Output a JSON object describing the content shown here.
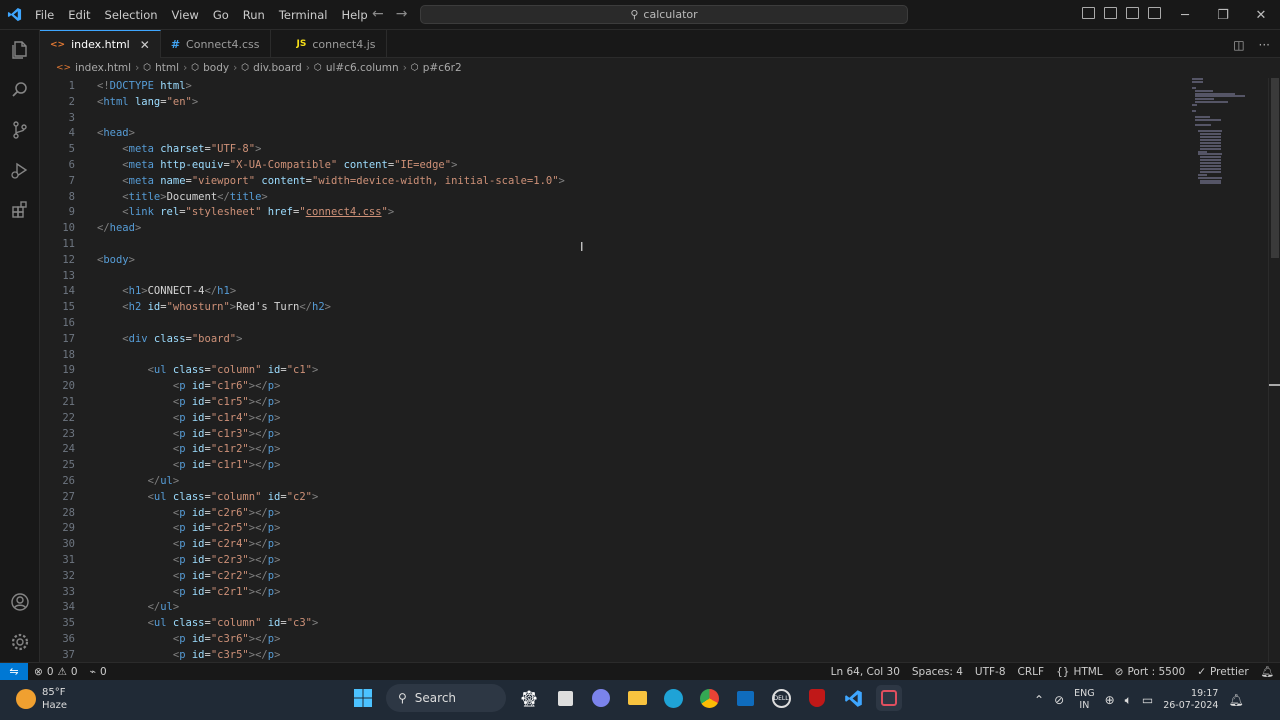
{
  "menu": [
    "File",
    "Edit",
    "Selection",
    "View",
    "Go",
    "Run",
    "Terminal",
    "Help"
  ],
  "search": {
    "text": "calculator"
  },
  "tabs": [
    {
      "label": "index.html",
      "icon": "<>",
      "color": "#e37933",
      "active": true
    },
    {
      "label": "Connect4.css",
      "icon": "#",
      "color": "#42a5f5",
      "active": false
    },
    {
      "label": "connect4.js",
      "icon": "JS",
      "color": "#f5de19",
      "active": false
    }
  ],
  "breadcrumb": [
    "index.html",
    "html",
    "body",
    "div.board",
    "ul#c6.column",
    "p#c6r2"
  ],
  "code": [
    [
      [
        "t",
        "<!"
      ],
      [
        "tn",
        "DOCTYPE "
      ],
      [
        "an",
        "html"
      ],
      [
        "t",
        ">"
      ]
    ],
    [
      [
        "t",
        "<"
      ],
      [
        "tn",
        "html "
      ],
      [
        "an",
        "lang"
      ],
      [
        "tx",
        "="
      ],
      [
        "av",
        "\"en\""
      ],
      [
        "t",
        ">"
      ]
    ],
    [],
    [
      [
        "t",
        "<"
      ],
      [
        "tn",
        "head"
      ],
      [
        "t",
        ">"
      ]
    ],
    [
      [
        "tx",
        "    "
      ],
      [
        "t",
        "<"
      ],
      [
        "tn",
        "meta "
      ],
      [
        "an",
        "charset"
      ],
      [
        "tx",
        "="
      ],
      [
        "av",
        "\"UTF-8\""
      ],
      [
        "t",
        ">"
      ]
    ],
    [
      [
        "tx",
        "    "
      ],
      [
        "t",
        "<"
      ],
      [
        "tn",
        "meta "
      ],
      [
        "an",
        "http-equiv"
      ],
      [
        "tx",
        "="
      ],
      [
        "av",
        "\"X-UA-Compatible\" "
      ],
      [
        "an",
        "content"
      ],
      [
        "tx",
        "="
      ],
      [
        "av",
        "\"IE=edge\""
      ],
      [
        "t",
        ">"
      ]
    ],
    [
      [
        "tx",
        "    "
      ],
      [
        "t",
        "<"
      ],
      [
        "tn",
        "meta "
      ],
      [
        "an",
        "name"
      ],
      [
        "tx",
        "="
      ],
      [
        "av",
        "\"viewport\" "
      ],
      [
        "an",
        "content"
      ],
      [
        "tx",
        "="
      ],
      [
        "av",
        "\"width=device-width, initial-scale=1.0\""
      ],
      [
        "t",
        ">"
      ]
    ],
    [
      [
        "tx",
        "    "
      ],
      [
        "t",
        "<"
      ],
      [
        "tn",
        "title"
      ],
      [
        "t",
        ">"
      ],
      [
        "tx",
        "Document"
      ],
      [
        "t",
        "</"
      ],
      [
        "tn",
        "title"
      ],
      [
        "t",
        ">"
      ]
    ],
    [
      [
        "tx",
        "    "
      ],
      [
        "t",
        "<"
      ],
      [
        "tn",
        "link "
      ],
      [
        "an",
        "rel"
      ],
      [
        "tx",
        "="
      ],
      [
        "av",
        "\"stylesheet\" "
      ],
      [
        "an",
        "href"
      ],
      [
        "tx",
        "="
      ],
      [
        "av",
        "\""
      ],
      [
        "avu",
        "connect4.css"
      ],
      [
        "av",
        "\""
      ],
      [
        "t",
        ">"
      ]
    ],
    [
      [
        "t",
        "</"
      ],
      [
        "tn",
        "head"
      ],
      [
        "t",
        ">"
      ]
    ],
    [],
    [
      [
        "t",
        "<"
      ],
      [
        "tn",
        "body"
      ],
      [
        "t",
        ">"
      ]
    ],
    [],
    [
      [
        "tx",
        "    "
      ],
      [
        "t",
        "<"
      ],
      [
        "tn",
        "h1"
      ],
      [
        "t",
        ">"
      ],
      [
        "tx",
        "CONNECT-4"
      ],
      [
        "t",
        "</"
      ],
      [
        "tn",
        "h1"
      ],
      [
        "t",
        ">"
      ]
    ],
    [
      [
        "tx",
        "    "
      ],
      [
        "t",
        "<"
      ],
      [
        "tn",
        "h2 "
      ],
      [
        "an",
        "id"
      ],
      [
        "tx",
        "="
      ],
      [
        "av",
        "\"whosturn\""
      ],
      [
        "t",
        ">"
      ],
      [
        "tx",
        "Red's Turn"
      ],
      [
        "t",
        "</"
      ],
      [
        "tn",
        "h2"
      ],
      [
        "t",
        ">"
      ]
    ],
    [],
    [
      [
        "tx",
        "    "
      ],
      [
        "t",
        "<"
      ],
      [
        "tn",
        "div "
      ],
      [
        "an",
        "class"
      ],
      [
        "tx",
        "="
      ],
      [
        "av",
        "\"board\""
      ],
      [
        "t",
        ">"
      ]
    ],
    [],
    [
      [
        "tx",
        "        "
      ],
      [
        "t",
        "<"
      ],
      [
        "tn",
        "ul "
      ],
      [
        "an",
        "class"
      ],
      [
        "tx",
        "="
      ],
      [
        "av",
        "\"column\" "
      ],
      [
        "an",
        "id"
      ],
      [
        "tx",
        "="
      ],
      [
        "av",
        "\"c1\""
      ],
      [
        "t",
        ">"
      ]
    ],
    [
      [
        "tx",
        "            "
      ],
      [
        "t",
        "<"
      ],
      [
        "tn",
        "p "
      ],
      [
        "an",
        "id"
      ],
      [
        "tx",
        "="
      ],
      [
        "av",
        "\"c1r6\""
      ],
      [
        "t",
        "></"
      ],
      [
        "tn",
        "p"
      ],
      [
        "t",
        ">"
      ]
    ],
    [
      [
        "tx",
        "            "
      ],
      [
        "t",
        "<"
      ],
      [
        "tn",
        "p "
      ],
      [
        "an",
        "id"
      ],
      [
        "tx",
        "="
      ],
      [
        "av",
        "\"c1r5\""
      ],
      [
        "t",
        "></"
      ],
      [
        "tn",
        "p"
      ],
      [
        "t",
        ">"
      ]
    ],
    [
      [
        "tx",
        "            "
      ],
      [
        "t",
        "<"
      ],
      [
        "tn",
        "p "
      ],
      [
        "an",
        "id"
      ],
      [
        "tx",
        "="
      ],
      [
        "av",
        "\"c1r4\""
      ],
      [
        "t",
        "></"
      ],
      [
        "tn",
        "p"
      ],
      [
        "t",
        ">"
      ]
    ],
    [
      [
        "tx",
        "            "
      ],
      [
        "t",
        "<"
      ],
      [
        "tn",
        "p "
      ],
      [
        "an",
        "id"
      ],
      [
        "tx",
        "="
      ],
      [
        "av",
        "\"c1r3\""
      ],
      [
        "t",
        "></"
      ],
      [
        "tn",
        "p"
      ],
      [
        "t",
        ">"
      ]
    ],
    [
      [
        "tx",
        "            "
      ],
      [
        "t",
        "<"
      ],
      [
        "tn",
        "p "
      ],
      [
        "an",
        "id"
      ],
      [
        "tx",
        "="
      ],
      [
        "av",
        "\"c1r2\""
      ],
      [
        "t",
        "></"
      ],
      [
        "tn",
        "p"
      ],
      [
        "t",
        ">"
      ]
    ],
    [
      [
        "tx",
        "            "
      ],
      [
        "t",
        "<"
      ],
      [
        "tn",
        "p "
      ],
      [
        "an",
        "id"
      ],
      [
        "tx",
        "="
      ],
      [
        "av",
        "\"c1r1\""
      ],
      [
        "t",
        "></"
      ],
      [
        "tn",
        "p"
      ],
      [
        "t",
        ">"
      ]
    ],
    [
      [
        "tx",
        "        "
      ],
      [
        "t",
        "</"
      ],
      [
        "tn",
        "ul"
      ],
      [
        "t",
        ">"
      ]
    ],
    [
      [
        "tx",
        "        "
      ],
      [
        "t",
        "<"
      ],
      [
        "tn",
        "ul "
      ],
      [
        "an",
        "class"
      ],
      [
        "tx",
        "="
      ],
      [
        "av",
        "\"column\" "
      ],
      [
        "an",
        "id"
      ],
      [
        "tx",
        "="
      ],
      [
        "av",
        "\"c2\""
      ],
      [
        "t",
        ">"
      ]
    ],
    [
      [
        "tx",
        "            "
      ],
      [
        "t",
        "<"
      ],
      [
        "tn",
        "p "
      ],
      [
        "an",
        "id"
      ],
      [
        "tx",
        "="
      ],
      [
        "av",
        "\"c2r6\""
      ],
      [
        "t",
        "></"
      ],
      [
        "tn",
        "p"
      ],
      [
        "t",
        ">"
      ]
    ],
    [
      [
        "tx",
        "            "
      ],
      [
        "t",
        "<"
      ],
      [
        "tn",
        "p "
      ],
      [
        "an",
        "id"
      ],
      [
        "tx",
        "="
      ],
      [
        "av",
        "\"c2r5\""
      ],
      [
        "t",
        "></"
      ],
      [
        "tn",
        "p"
      ],
      [
        "t",
        ">"
      ]
    ],
    [
      [
        "tx",
        "            "
      ],
      [
        "t",
        "<"
      ],
      [
        "tn",
        "p "
      ],
      [
        "an",
        "id"
      ],
      [
        "tx",
        "="
      ],
      [
        "av",
        "\"c2r4\""
      ],
      [
        "t",
        "></"
      ],
      [
        "tn",
        "p"
      ],
      [
        "t",
        ">"
      ]
    ],
    [
      [
        "tx",
        "            "
      ],
      [
        "t",
        "<"
      ],
      [
        "tn",
        "p "
      ],
      [
        "an",
        "id"
      ],
      [
        "tx",
        "="
      ],
      [
        "av",
        "\"c2r3\""
      ],
      [
        "t",
        "></"
      ],
      [
        "tn",
        "p"
      ],
      [
        "t",
        ">"
      ]
    ],
    [
      [
        "tx",
        "            "
      ],
      [
        "t",
        "<"
      ],
      [
        "tn",
        "p "
      ],
      [
        "an",
        "id"
      ],
      [
        "tx",
        "="
      ],
      [
        "av",
        "\"c2r2\""
      ],
      [
        "t",
        "></"
      ],
      [
        "tn",
        "p"
      ],
      [
        "t",
        ">"
      ]
    ],
    [
      [
        "tx",
        "            "
      ],
      [
        "t",
        "<"
      ],
      [
        "tn",
        "p "
      ],
      [
        "an",
        "id"
      ],
      [
        "tx",
        "="
      ],
      [
        "av",
        "\"c2r1\""
      ],
      [
        "t",
        "></"
      ],
      [
        "tn",
        "p"
      ],
      [
        "t",
        ">"
      ]
    ],
    [
      [
        "tx",
        "        "
      ],
      [
        "t",
        "</"
      ],
      [
        "tn",
        "ul"
      ],
      [
        "t",
        ">"
      ]
    ],
    [
      [
        "tx",
        "        "
      ],
      [
        "t",
        "<"
      ],
      [
        "tn",
        "ul "
      ],
      [
        "an",
        "class"
      ],
      [
        "tx",
        "="
      ],
      [
        "av",
        "\"column\" "
      ],
      [
        "an",
        "id"
      ],
      [
        "tx",
        "="
      ],
      [
        "av",
        "\"c3\""
      ],
      [
        "t",
        ">"
      ]
    ],
    [
      [
        "tx",
        "            "
      ],
      [
        "t",
        "<"
      ],
      [
        "tn",
        "p "
      ],
      [
        "an",
        "id"
      ],
      [
        "tx",
        "="
      ],
      [
        "av",
        "\"c3r6\""
      ],
      [
        "t",
        "></"
      ],
      [
        "tn",
        "p"
      ],
      [
        "t",
        ">"
      ]
    ],
    [
      [
        "tx",
        "            "
      ],
      [
        "t",
        "<"
      ],
      [
        "tn",
        "p "
      ],
      [
        "an",
        "id"
      ],
      [
        "tx",
        "="
      ],
      [
        "av",
        "\"c3r5\""
      ],
      [
        "t",
        "></"
      ],
      [
        "tn",
        "p"
      ],
      [
        "t",
        ">"
      ]
    ]
  ],
  "status": {
    "errors": "0",
    "warnings": "0",
    "ports": "0",
    "position": "Ln 64, Col 30",
    "spaces": "Spaces: 4",
    "encoding": "UTF-8",
    "eol": "CRLF",
    "language": "HTML",
    "port": "Port : 5500",
    "formatter": "Prettier"
  },
  "taskbar": {
    "temp": "85°F",
    "weather": "Haze",
    "search": "Search",
    "lang1": "ENG",
    "lang2": "IN",
    "time": "19:17",
    "date": "26-07-2024"
  },
  "colors": {
    "accent": "#0078d4",
    "tab_html": "#e37933",
    "tab_css": "#42a5f5",
    "tab_js": "#f5de19"
  }
}
